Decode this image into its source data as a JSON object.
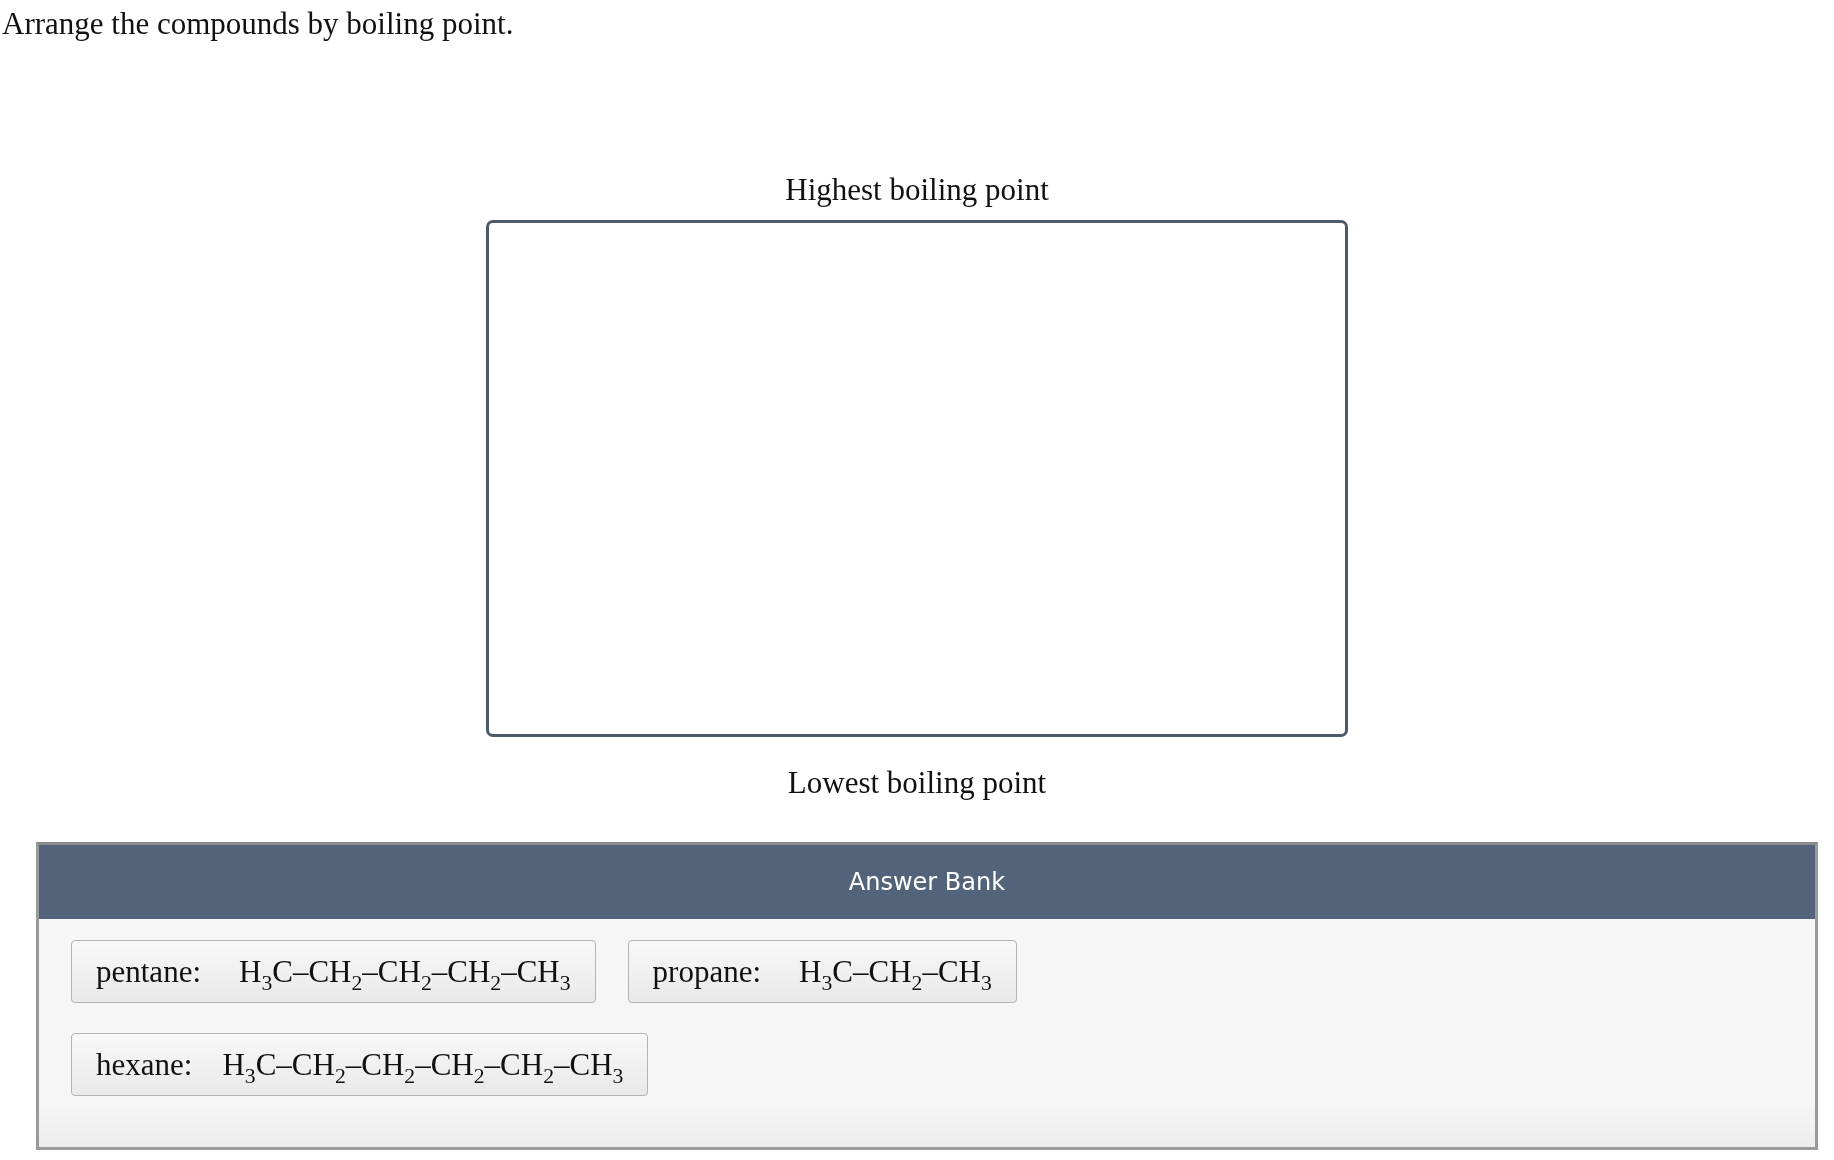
{
  "prompt": "Arrange the compounds by boiling point.",
  "sort_area": {
    "top_label": "Highest boiling point",
    "bottom_label": "Lowest boiling point"
  },
  "answer_bank": {
    "title": "Answer Bank",
    "items": [
      {
        "name": "pentane:",
        "formula": "H$_{3}$C–CH$_{2}$–CH$_{2}$–CH$_{2}$–CH$_{3}$"
      },
      {
        "name": "propane:",
        "formula": "H$_{3}$C–CH$_{2}$–CH$_{3}$"
      },
      {
        "name": "hexane:",
        "formula": "H$_{3}$C–CH$_{2}$–CH$_{2}$–CH$_{2}$–CH$_{2}$–CH$_{3}$"
      }
    ]
  }
}
